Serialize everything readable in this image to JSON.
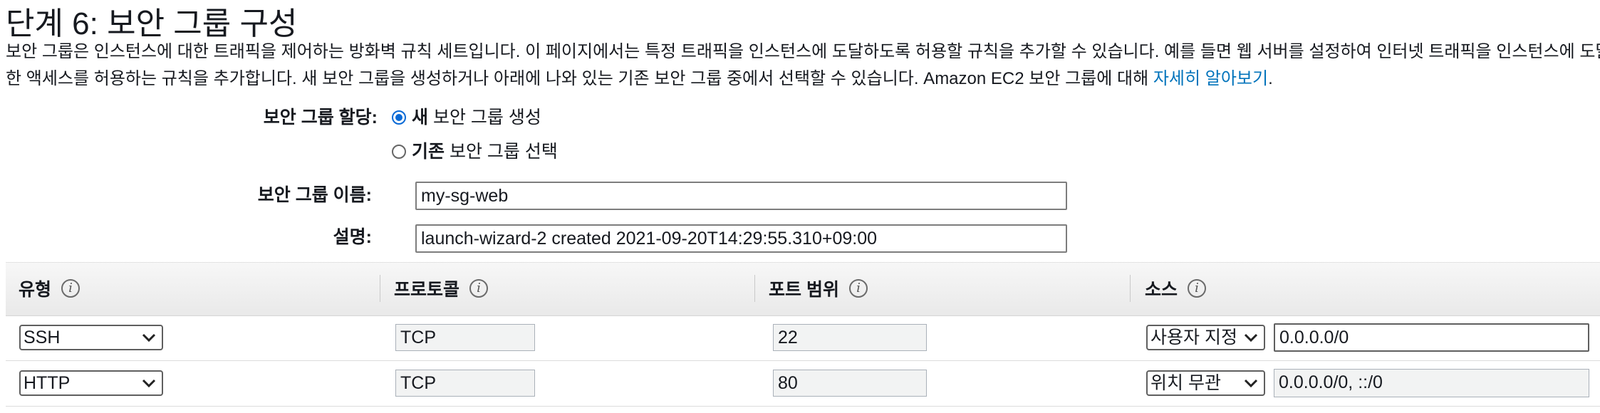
{
  "page": {
    "title": "단계 6: 보안 그룹 구성",
    "desc_line1": "보안 그룹은 인스턴스에 대한 트래픽을 제어하는 방화벽 규칙 세트입니다. 이 페이지에서는 특정 트래픽을 인스턴스에 도달하도록 허용할 규칙을 추가할 수 있습니다. 예를 들면 웹 서버를 설정하여 인터넷 트래픽을 인스턴스에 도달",
    "desc_line2": "한 액세스를 허용하는 규칙을 추가합니다. 새 보안 그룹을 생성하거나 아래에 나와 있는 기존 보안 그룹 중에서 선택할 수 있습니다. Amazon EC2 보안 그룹에 대해",
    "learn_more": "자세히 알아보기",
    "learn_more_suffix": "."
  },
  "form": {
    "assign_label": "보안 그룹 할당:",
    "option_new_bold": "새",
    "option_new_rest": " 보안 그룹 생성",
    "option_existing_bold": "기존",
    "option_existing_rest": " 보안 그룹 선택",
    "selected_option": "new",
    "name_label": "보안 그룹 이름:",
    "name_value": "my-sg-web",
    "desc_label": "설명:",
    "desc_value": "launch-wizard-2 created 2021-09-20T14:29:55.310+09:00"
  },
  "table": {
    "columns": [
      "유형",
      "프로토콜",
      "포트 범위",
      "소스"
    ],
    "rows": [
      {
        "type": "SSH",
        "protocol": "TCP",
        "port": "22",
        "source_mode": "사용자 지정",
        "source_value": "0.0.0.0/0"
      },
      {
        "type": "HTTP",
        "protocol": "TCP",
        "port": "80",
        "source_mode": "위치 무관",
        "source_value": "0.0.0.0/0, ::/0"
      }
    ]
  },
  "icons": {
    "info": "info-icon",
    "chevron": "chevron-down-icon"
  },
  "colors": {
    "link": "#0073bb",
    "radio_selected": "#0a6ad6"
  }
}
